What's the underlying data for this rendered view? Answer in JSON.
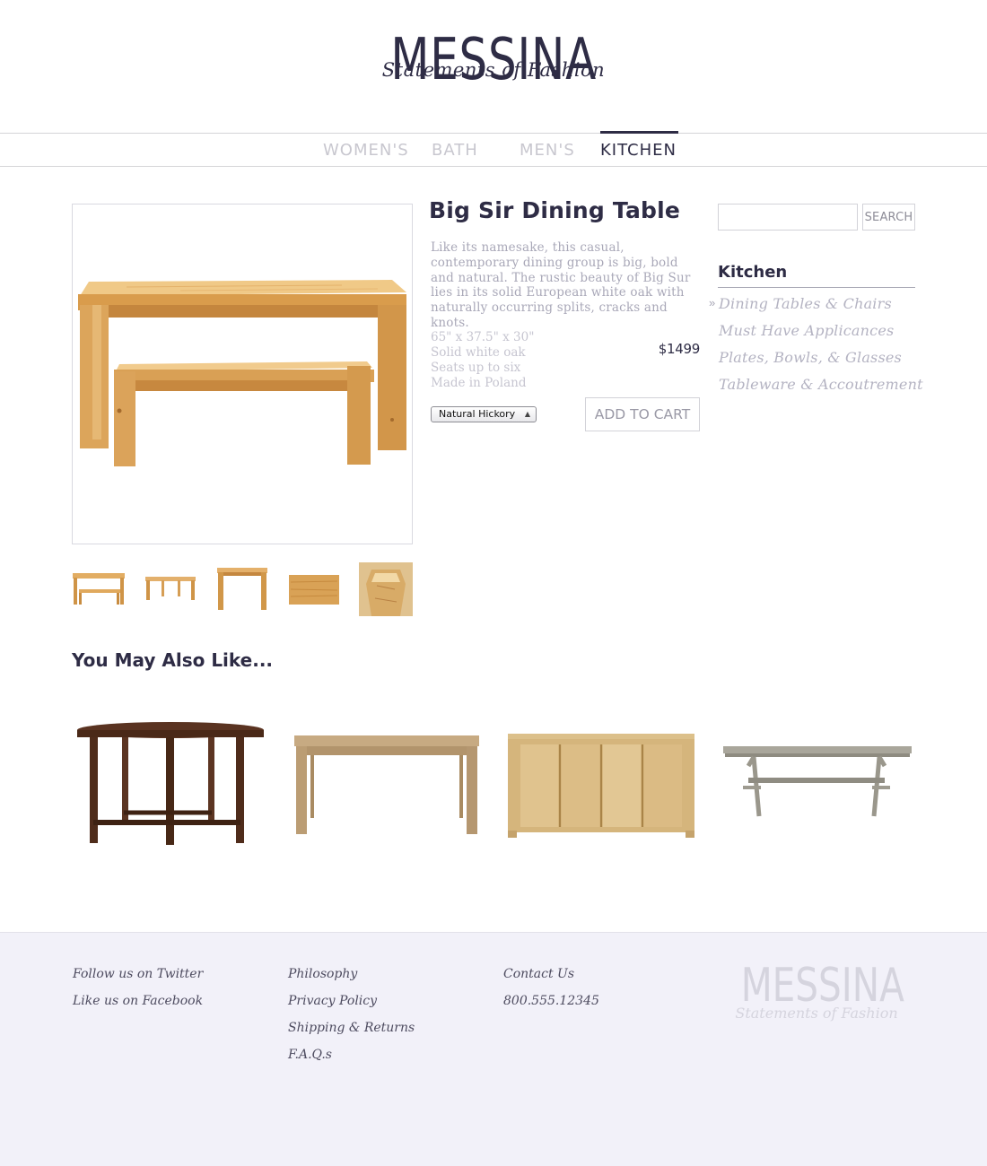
{
  "brand": {
    "name": "MESSINA",
    "tagline": "Statements of Fashion"
  },
  "nav": {
    "items": [
      "WOMEN'S",
      "BATH",
      "MEN'S",
      "KITCHEN"
    ],
    "active": "KITCHEN"
  },
  "product": {
    "title": "Big Sir Dining Table",
    "description": "Like its namesake, this casual, contemporary dining group is big, bold and natural. The rustic beauty of Big Sur lies in its solid European white oak with naturally occurring splits, cracks and knots.",
    "specs": [
      "65\" x 37.5\" x 30\"",
      "Solid white oak",
      "Seats up to six",
      "Made in Poland"
    ],
    "price": "$1499",
    "finish_selected": "Natural Hickory",
    "add_to_cart_label": "ADD TO CART",
    "thumbnails": [
      "table-and-bench-thumb",
      "table-side-thumb",
      "table-end-thumb",
      "tabletop-grain-thumb",
      "leg-detail-thumb"
    ]
  },
  "sidebar": {
    "search_button": "SEARCH",
    "search_placeholder": "",
    "category_title": "Kitchen",
    "links": [
      "Dining Tables & Chairs",
      "Must Have Applicances",
      "Plates, Bowls, & Glasses",
      "Tableware & Accoutrement"
    ],
    "active_link": "Dining Tables & Chairs"
  },
  "also_like": {
    "title": "You May Also Like...",
    "items": [
      "round-dark-wood-table",
      "light-wood-dining-table",
      "oak-sideboard-cabinet",
      "trestle-table-gray"
    ]
  },
  "footer": {
    "col1": [
      "Follow us on Twitter",
      "Like us on Facebook"
    ],
    "col2": [
      "Philosophy",
      "Privacy Policy",
      "Shipping & Returns",
      "F.A.Q.s"
    ],
    "col3_link": "Contact Us",
    "col3_phone": "800.555.12345",
    "brand_name": "MESSINA",
    "brand_tagline": "Statements of Fashion"
  },
  "colors": {
    "brand": "#2e2c45",
    "muted_nav": "#c8c7cf",
    "body_text": "#a9a8b8",
    "wood": "#e2b26a",
    "footer_bg": "#f2f1f9"
  }
}
